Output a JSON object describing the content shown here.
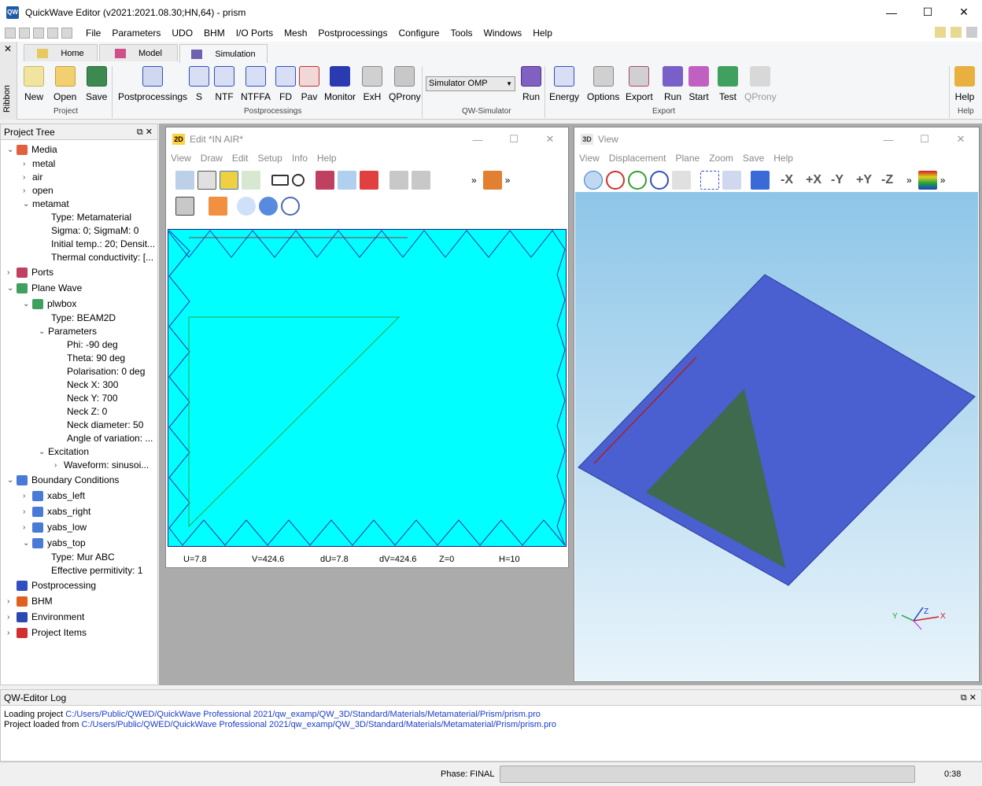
{
  "window": {
    "title": "QuickWave Editor (v2021:2021.08.30;HN,64) - prism",
    "app_icon": "QW"
  },
  "menu": [
    "File",
    "Parameters",
    "UDO",
    "BHM",
    "I/O Ports",
    "Mesh",
    "Postprocessings",
    "Configure",
    "Tools",
    "Windows",
    "Help"
  ],
  "ribbon": {
    "side_label": "Ribbon",
    "tabs": [
      "Home",
      "Model",
      "Simulation"
    ],
    "active_tab": "Simulation",
    "project": {
      "group": "Project",
      "buttons": [
        "New",
        "Open",
        "Save"
      ]
    },
    "postprocessings": {
      "group": "Postprocessings",
      "buttons": [
        "Postprocessings",
        "S",
        "NTF",
        "NTFFA",
        "FD",
        "Pav",
        "Monitor",
        "ExH",
        "QProny"
      ]
    },
    "simulator": {
      "group": "QW-Simulator",
      "select": "Simulator OMP",
      "button": "Run"
    },
    "export": {
      "group": "Export",
      "buttons": [
        "Energy",
        "Options",
        "Export",
        "Run",
        "Start",
        "Test",
        "QProny"
      ]
    },
    "help": {
      "group": "Help",
      "button": "Help"
    }
  },
  "project_tree": {
    "title": "Project Tree",
    "items": [
      {
        "label": "Media",
        "depth": 0
      },
      {
        "label": "metal",
        "depth": 1
      },
      {
        "label": "air",
        "depth": 1
      },
      {
        "label": "open",
        "depth": 1
      },
      {
        "label": "metamat",
        "depth": 1
      },
      {
        "label": "Type: Metamaterial",
        "depth": 2
      },
      {
        "label": "Sigma: 0; SigmaM: 0",
        "depth": 2
      },
      {
        "label": "Initial temp.: 20; Densit...",
        "depth": 2
      },
      {
        "label": "Thermal conductivity: [...",
        "depth": 2
      },
      {
        "label": "Ports",
        "depth": 0
      },
      {
        "label": "Plane Wave",
        "depth": 0
      },
      {
        "label": "plwbox",
        "depth": 1
      },
      {
        "label": "Type: BEAM2D",
        "depth": 2
      },
      {
        "label": "Parameters",
        "depth": 2
      },
      {
        "label": "Phi: -90 deg",
        "depth": 3
      },
      {
        "label": "Theta: 90 deg",
        "depth": 3
      },
      {
        "label": "Polarisation: 0 deg",
        "depth": 3
      },
      {
        "label": "Neck X: 300",
        "depth": 3
      },
      {
        "label": "Neck Y: 700",
        "depth": 3
      },
      {
        "label": "Neck Z: 0",
        "depth": 3
      },
      {
        "label": "Neck diameter: 50",
        "depth": 3
      },
      {
        "label": "Angle of variation: ...",
        "depth": 3
      },
      {
        "label": "Excitation",
        "depth": 2
      },
      {
        "label": "Waveform: sinusoi...",
        "depth": 3
      },
      {
        "label": "Boundary Conditions",
        "depth": 0
      },
      {
        "label": "xabs_left",
        "depth": 1
      },
      {
        "label": "xabs_right",
        "depth": 1
      },
      {
        "label": "yabs_low",
        "depth": 1
      },
      {
        "label": "yabs_top",
        "depth": 1
      },
      {
        "label": "Type: Mur ABC",
        "depth": 2
      },
      {
        "label": "Effective permitivity: 1",
        "depth": 2
      },
      {
        "label": "Postprocessing",
        "depth": 0
      },
      {
        "label": "BHM",
        "depth": 0
      },
      {
        "label": "Environment",
        "depth": 0
      },
      {
        "label": "Project Items",
        "depth": 0
      }
    ]
  },
  "edit2d": {
    "title": "Edit  *IN AIR*",
    "badge": "2D",
    "menu": [
      "View",
      "Draw",
      "Edit",
      "Setup",
      "Info",
      "Help"
    ],
    "status": {
      "u": "U=7.8",
      "v": "V=424.6",
      "du": "dU=7.8",
      "dv": "dV=424.6",
      "z": "Z=0",
      "h": "H=10"
    }
  },
  "view3d": {
    "title": "View",
    "badge": "3D",
    "menu": [
      "View",
      "Displacement",
      "Plane",
      "Zoom",
      "Save",
      "Help"
    ],
    "axis_buttons": [
      "-X",
      "+X",
      "-Y",
      "+Y",
      "-Z"
    ],
    "axes": {
      "x": "X",
      "y": "Y",
      "z": "Z"
    }
  },
  "log": {
    "title": "QW-Editor Log",
    "lines": [
      {
        "prefix": "Loading project ",
        "path": "C:/Users/Public/QWED/QuickWave Professional 2021/qw_examp/QW_3D/Standard/Materials/Metamaterial/Prism/prism.pro"
      },
      {
        "prefix": "Project loaded from ",
        "path": "C:/Users/Public/QWED/QuickWave Professional 2021/qw_examp/QW_3D/Standard/Materials/Metamaterial/Prism/prism.pro"
      }
    ]
  },
  "status": {
    "phase": "Phase: FINAL",
    "time": "0:38"
  },
  "colors": {
    "canvas": "#00ffff",
    "plate": "#4a5fd0",
    "prism": "#3f6a4e",
    "sky_top": "#8ec6e8",
    "sky_bottom": "#e9f4fb"
  }
}
